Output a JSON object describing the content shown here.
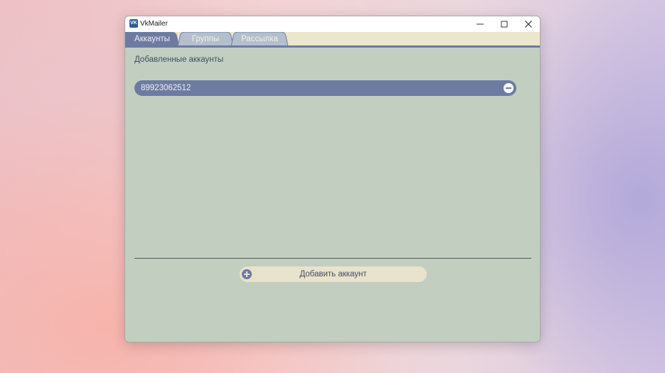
{
  "window": {
    "title": "VkMailer",
    "icon_text": "VK",
    "controls": [
      "minimize-icon",
      "maximize-icon",
      "close-icon"
    ]
  },
  "tabs": [
    {
      "label": "Аккаунты",
      "active": true
    },
    {
      "label": "Группы",
      "active": false
    },
    {
      "label": "Рассылка",
      "active": false
    }
  ],
  "accounts_page": {
    "section_title": "Добавленные аккаунты",
    "accounts": [
      {
        "number": "89923062512"
      }
    ],
    "add_button_label": "Добавить аккаунт"
  },
  "colors": {
    "content_bg": "#c2cfc0",
    "accent": "#6d7ba3",
    "tab_bar": "#ece6cc",
    "button_bg": "#e9e2cc"
  }
}
